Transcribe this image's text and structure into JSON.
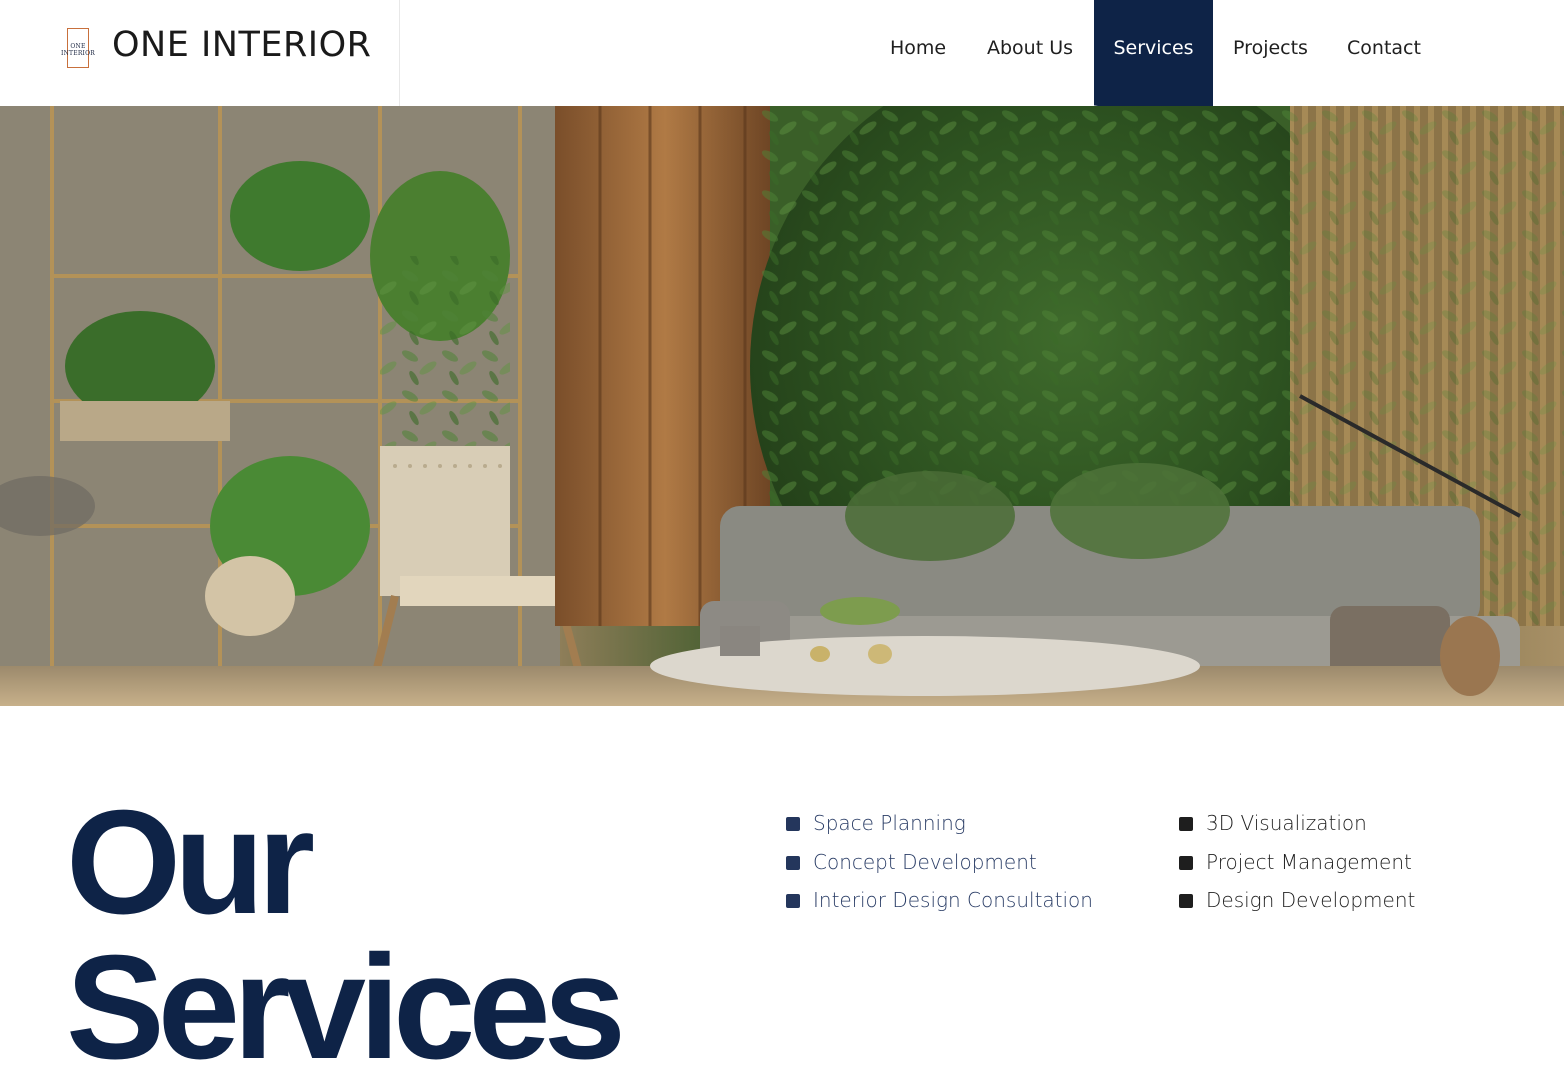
{
  "header": {
    "logo_small_text": "ONE INTERIOR",
    "brand_name": "ONE INTERIOR",
    "nav": [
      {
        "label": "Home",
        "active": false
      },
      {
        "label": "About Us",
        "active": false
      },
      {
        "label": "Services",
        "active": true
      },
      {
        "label": "Projects",
        "active": false
      },
      {
        "label": "Contact",
        "active": false
      }
    ]
  },
  "hero": {
    "image": "interior-living-room-with-green-wall-photo"
  },
  "services": {
    "title_line1": "Our",
    "title_line2": "Services",
    "column_a": [
      "Space Planning",
      "Concept Development",
      "Interior Design Consultation"
    ],
    "column_b": [
      "3D Visualization",
      "Project Management",
      "Design Development"
    ]
  },
  "colors": {
    "navy": "#0e2347",
    "accent_orange": "#c8703c",
    "text_dark": "#1e1e1e",
    "service_blue": "#2a3d66"
  }
}
